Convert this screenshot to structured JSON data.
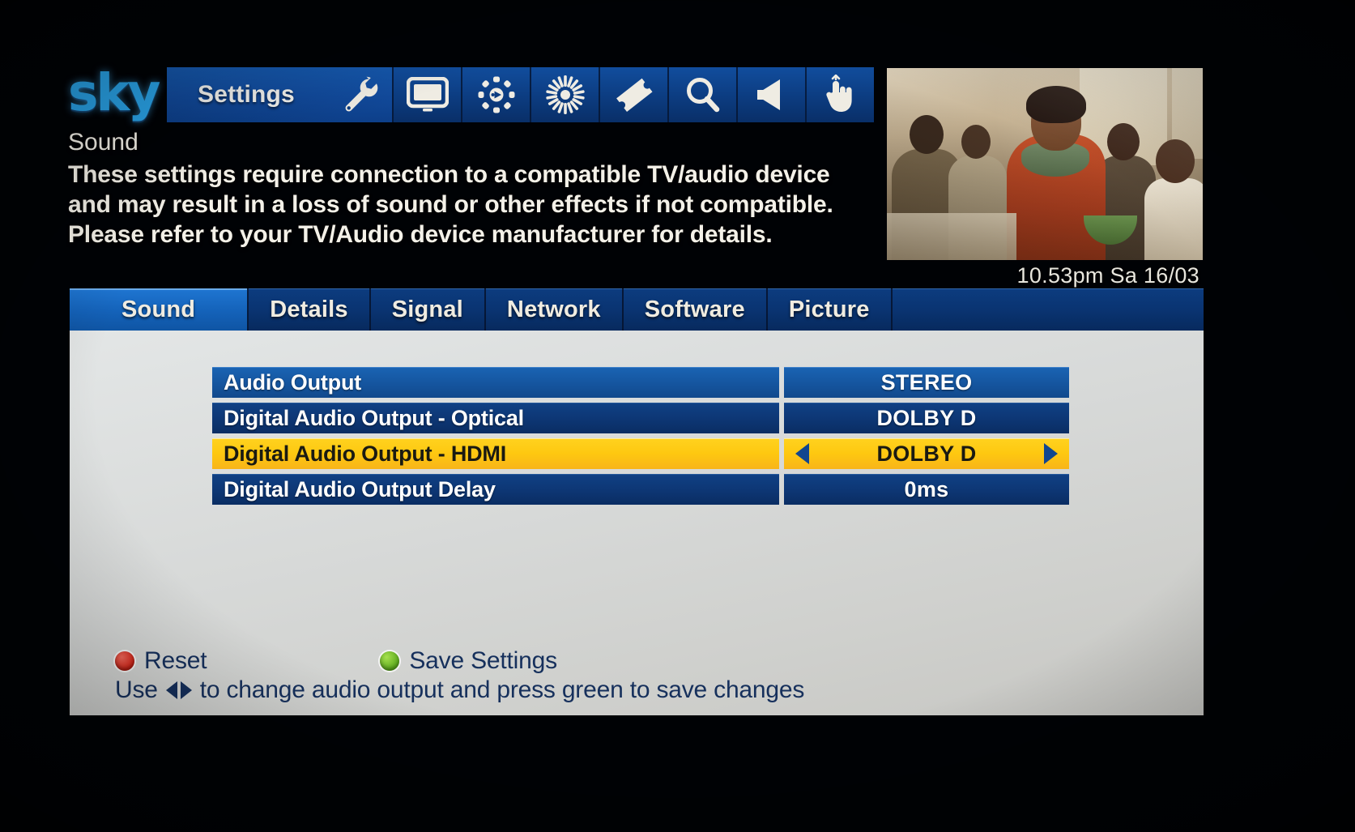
{
  "brand": {
    "logo_text": "sky"
  },
  "menubar": {
    "title": "Settings",
    "icons": [
      {
        "name": "wrench-icon",
        "label": "Settings"
      },
      {
        "name": "tv-icon",
        "label": "TV"
      },
      {
        "name": "media-play-circle-icon",
        "label": "Media"
      },
      {
        "name": "sun-burst-icon",
        "label": "Brightness"
      },
      {
        "name": "ticket-icon",
        "label": "Box Office"
      },
      {
        "name": "search-icon",
        "label": "Search"
      },
      {
        "name": "speaker-icon",
        "label": "Sound"
      },
      {
        "name": "hand-touch-icon",
        "label": "Interactive"
      }
    ]
  },
  "info": {
    "section_name": "Sound",
    "description_lines": [
      "These settings require connection to a compatible TV/audio device",
      "and may result in a loss of sound or other effects if not compatible.",
      "Please refer to your TV/Audio device manufacturer for details."
    ]
  },
  "clock": {
    "text": "10.53pm Sa 16/03"
  },
  "tabs": [
    {
      "label": "Sound",
      "active": true
    },
    {
      "label": "Details",
      "active": false
    },
    {
      "label": "Signal",
      "active": false
    },
    {
      "label": "Network",
      "active": false
    },
    {
      "label": "Software",
      "active": false
    },
    {
      "label": "Picture",
      "active": false
    }
  ],
  "settings_rows": [
    {
      "label": "Audio Output",
      "value": "STEREO",
      "selected": false,
      "style": "top",
      "arrows": false
    },
    {
      "label": "Digital Audio Output - Optical",
      "value": "DOLBY D",
      "selected": false,
      "style": "dark",
      "arrows": false
    },
    {
      "label": "Digital Audio Output - HDMI",
      "value": "DOLBY D",
      "selected": true,
      "style": "dark",
      "arrows": true
    },
    {
      "label": "Digital Audio Output Delay",
      "value": "0ms",
      "selected": false,
      "style": "dark",
      "arrows": false
    }
  ],
  "footer": {
    "reset_label": "Reset",
    "save_label": "Save Settings",
    "reset_color": "#d32316",
    "save_color": "#5aa81c",
    "hint_prefix": "Use",
    "hint_suffix": "to change audio output and press green to save changes"
  },
  "colors": {
    "accent_blue": "#1462b9",
    "panel_bg": "#d7d9d8",
    "highlight_yellow": "#fec810",
    "row_blue": "#15559f",
    "row_dark_blue": "#0d3674",
    "sky_logo": "#29a3e8"
  }
}
